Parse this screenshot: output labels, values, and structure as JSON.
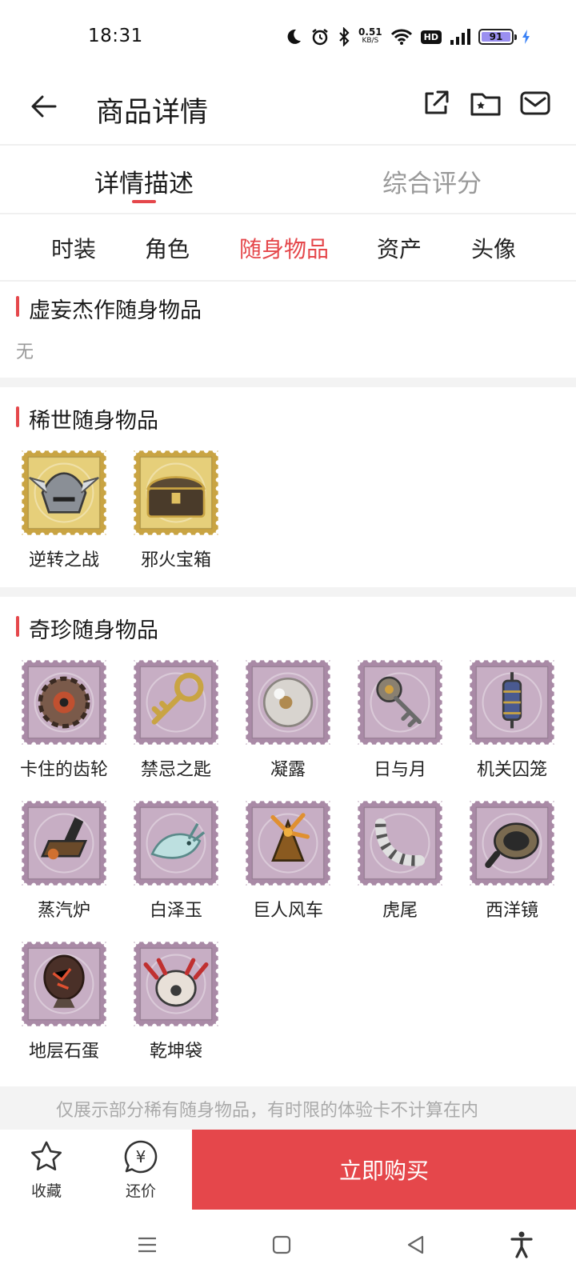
{
  "status_bar": {
    "time": "18:31",
    "net_speed": "0.51",
    "net_unit": "KB/S",
    "hd": "HD",
    "battery": "91",
    "icons": [
      "moon-icon",
      "alarm-icon",
      "bluetooth-icon",
      "wifi-icon",
      "signal-icon",
      "charging-icon"
    ]
  },
  "header": {
    "title": "商品详情",
    "icons": [
      "back-arrow-icon",
      "share-icon",
      "folder-star-icon",
      "mail-icon"
    ]
  },
  "main_tabs": [
    {
      "label": "详情描述",
      "active": true
    },
    {
      "label": "综合评分",
      "active": false
    }
  ],
  "sub_tabs": [
    {
      "label": "时装",
      "active": false
    },
    {
      "label": "角色",
      "active": false
    },
    {
      "label": "随身物品",
      "active": true
    },
    {
      "label": "资产",
      "active": false
    },
    {
      "label": "头像",
      "active": false
    }
  ],
  "sections": {
    "legendary": {
      "title": "虚妄杰作随身物品",
      "empty_text": "无"
    },
    "rare": {
      "title": "稀世随身物品",
      "frame": "gold",
      "items": [
        {
          "name": "逆转之战",
          "icon": "winged-helmet-icon"
        },
        {
          "name": "邪火宝箱",
          "icon": "treasure-chest-icon"
        }
      ]
    },
    "exotic": {
      "title": "奇珍随身物品",
      "frame": "purple",
      "items": [
        {
          "name": "卡住的齿轮",
          "icon": "gear-icon"
        },
        {
          "name": "禁忌之匙",
          "icon": "golden-key-icon"
        },
        {
          "name": "凝露",
          "icon": "dew-pearl-icon"
        },
        {
          "name": "日与月",
          "icon": "sun-moon-key-icon"
        },
        {
          "name": "机关囚笼",
          "icon": "cage-lantern-icon"
        },
        {
          "name": "蒸汽炉",
          "icon": "steam-furnace-icon"
        },
        {
          "name": "白泽玉",
          "icon": "jade-beast-icon"
        },
        {
          "name": "巨人风车",
          "icon": "windmill-icon"
        },
        {
          "name": "虎尾",
          "icon": "tiger-tail-icon"
        },
        {
          "name": "西洋镜",
          "icon": "spyglass-icon"
        },
        {
          "name": "地层石蛋",
          "icon": "stone-egg-icon"
        },
        {
          "name": "乾坤袋",
          "icon": "magic-bag-icon"
        }
      ]
    }
  },
  "note": "仅展示部分稀有随身物品，有时限的体验卡不计算在内",
  "bottom_bar": {
    "favorite_label": "收藏",
    "bargain_label": "还价",
    "bargain_symbol": "¥",
    "buy_label": "立即购买",
    "buy_color": "#e5474b"
  },
  "colors": {
    "accent": "#e5474b",
    "gold_frame": "#c9a443",
    "purple_frame": "#a98aa6"
  }
}
